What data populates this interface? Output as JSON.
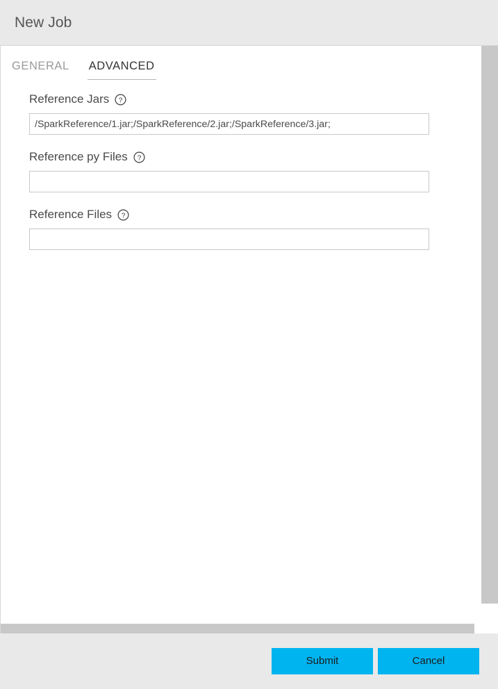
{
  "dialog": {
    "title": "New Job"
  },
  "tabs": [
    {
      "label": "GENERAL",
      "active": false
    },
    {
      "label": "ADVANCED",
      "active": true
    }
  ],
  "form": {
    "fields": [
      {
        "label": "Reference Jars",
        "help_icon": "help-circle-icon",
        "value": "/SparkReference/1.jar;/SparkReference/2.jar;/SparkReference/3.jar;",
        "placeholder": ""
      },
      {
        "label": "Reference py Files",
        "help_icon": "help-circle-icon",
        "value": "",
        "placeholder": ""
      },
      {
        "label": "Reference Files",
        "help_icon": "help-circle-icon",
        "value": "",
        "placeholder": ""
      }
    ]
  },
  "footer": {
    "submit_label": "Submit",
    "cancel_label": "Cancel"
  },
  "colors": {
    "accent": "#00b4f0",
    "titlebar_bg": "#e9e9e9",
    "footer_bg": "#e9e9e9",
    "scrollbar_thumb": "#c8c8c8",
    "tab_active_text": "#333333",
    "tab_inactive_text": "#9a9a9a",
    "input_border": "#c8c8c8"
  },
  "scrollbars": {
    "vertical_name": "vertical-scrollbar",
    "horizontal_name": "horizontal-scrollbar"
  }
}
